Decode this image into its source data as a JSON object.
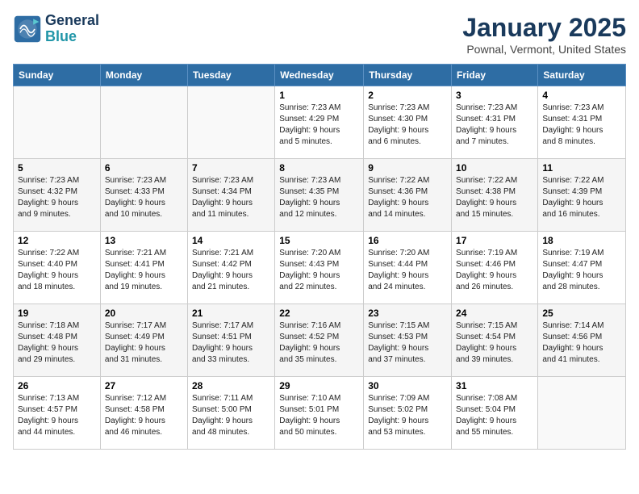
{
  "logo": {
    "line1": "General",
    "line2": "Blue"
  },
  "header": {
    "month": "January 2025",
    "location": "Pownal, Vermont, United States"
  },
  "weekdays": [
    "Sunday",
    "Monday",
    "Tuesday",
    "Wednesday",
    "Thursday",
    "Friday",
    "Saturday"
  ],
  "weeks": [
    [
      {
        "day": "",
        "info": ""
      },
      {
        "day": "",
        "info": ""
      },
      {
        "day": "",
        "info": ""
      },
      {
        "day": "1",
        "info": "Sunrise: 7:23 AM\nSunset: 4:29 PM\nDaylight: 9 hours\nand 5 minutes."
      },
      {
        "day": "2",
        "info": "Sunrise: 7:23 AM\nSunset: 4:30 PM\nDaylight: 9 hours\nand 6 minutes."
      },
      {
        "day": "3",
        "info": "Sunrise: 7:23 AM\nSunset: 4:31 PM\nDaylight: 9 hours\nand 7 minutes."
      },
      {
        "day": "4",
        "info": "Sunrise: 7:23 AM\nSunset: 4:31 PM\nDaylight: 9 hours\nand 8 minutes."
      }
    ],
    [
      {
        "day": "5",
        "info": "Sunrise: 7:23 AM\nSunset: 4:32 PM\nDaylight: 9 hours\nand 9 minutes."
      },
      {
        "day": "6",
        "info": "Sunrise: 7:23 AM\nSunset: 4:33 PM\nDaylight: 9 hours\nand 10 minutes."
      },
      {
        "day": "7",
        "info": "Sunrise: 7:23 AM\nSunset: 4:34 PM\nDaylight: 9 hours\nand 11 minutes."
      },
      {
        "day": "8",
        "info": "Sunrise: 7:23 AM\nSunset: 4:35 PM\nDaylight: 9 hours\nand 12 minutes."
      },
      {
        "day": "9",
        "info": "Sunrise: 7:22 AM\nSunset: 4:36 PM\nDaylight: 9 hours\nand 14 minutes."
      },
      {
        "day": "10",
        "info": "Sunrise: 7:22 AM\nSunset: 4:38 PM\nDaylight: 9 hours\nand 15 minutes."
      },
      {
        "day": "11",
        "info": "Sunrise: 7:22 AM\nSunset: 4:39 PM\nDaylight: 9 hours\nand 16 minutes."
      }
    ],
    [
      {
        "day": "12",
        "info": "Sunrise: 7:22 AM\nSunset: 4:40 PM\nDaylight: 9 hours\nand 18 minutes."
      },
      {
        "day": "13",
        "info": "Sunrise: 7:21 AM\nSunset: 4:41 PM\nDaylight: 9 hours\nand 19 minutes."
      },
      {
        "day": "14",
        "info": "Sunrise: 7:21 AM\nSunset: 4:42 PM\nDaylight: 9 hours\nand 21 minutes."
      },
      {
        "day": "15",
        "info": "Sunrise: 7:20 AM\nSunset: 4:43 PM\nDaylight: 9 hours\nand 22 minutes."
      },
      {
        "day": "16",
        "info": "Sunrise: 7:20 AM\nSunset: 4:44 PM\nDaylight: 9 hours\nand 24 minutes."
      },
      {
        "day": "17",
        "info": "Sunrise: 7:19 AM\nSunset: 4:46 PM\nDaylight: 9 hours\nand 26 minutes."
      },
      {
        "day": "18",
        "info": "Sunrise: 7:19 AM\nSunset: 4:47 PM\nDaylight: 9 hours\nand 28 minutes."
      }
    ],
    [
      {
        "day": "19",
        "info": "Sunrise: 7:18 AM\nSunset: 4:48 PM\nDaylight: 9 hours\nand 29 minutes."
      },
      {
        "day": "20",
        "info": "Sunrise: 7:17 AM\nSunset: 4:49 PM\nDaylight: 9 hours\nand 31 minutes."
      },
      {
        "day": "21",
        "info": "Sunrise: 7:17 AM\nSunset: 4:51 PM\nDaylight: 9 hours\nand 33 minutes."
      },
      {
        "day": "22",
        "info": "Sunrise: 7:16 AM\nSunset: 4:52 PM\nDaylight: 9 hours\nand 35 minutes."
      },
      {
        "day": "23",
        "info": "Sunrise: 7:15 AM\nSunset: 4:53 PM\nDaylight: 9 hours\nand 37 minutes."
      },
      {
        "day": "24",
        "info": "Sunrise: 7:15 AM\nSunset: 4:54 PM\nDaylight: 9 hours\nand 39 minutes."
      },
      {
        "day": "25",
        "info": "Sunrise: 7:14 AM\nSunset: 4:56 PM\nDaylight: 9 hours\nand 41 minutes."
      }
    ],
    [
      {
        "day": "26",
        "info": "Sunrise: 7:13 AM\nSunset: 4:57 PM\nDaylight: 9 hours\nand 44 minutes."
      },
      {
        "day": "27",
        "info": "Sunrise: 7:12 AM\nSunset: 4:58 PM\nDaylight: 9 hours\nand 46 minutes."
      },
      {
        "day": "28",
        "info": "Sunrise: 7:11 AM\nSunset: 5:00 PM\nDaylight: 9 hours\nand 48 minutes."
      },
      {
        "day": "29",
        "info": "Sunrise: 7:10 AM\nSunset: 5:01 PM\nDaylight: 9 hours\nand 50 minutes."
      },
      {
        "day": "30",
        "info": "Sunrise: 7:09 AM\nSunset: 5:02 PM\nDaylight: 9 hours\nand 53 minutes."
      },
      {
        "day": "31",
        "info": "Sunrise: 7:08 AM\nSunset: 5:04 PM\nDaylight: 9 hours\nand 55 minutes."
      },
      {
        "day": "",
        "info": ""
      }
    ]
  ]
}
